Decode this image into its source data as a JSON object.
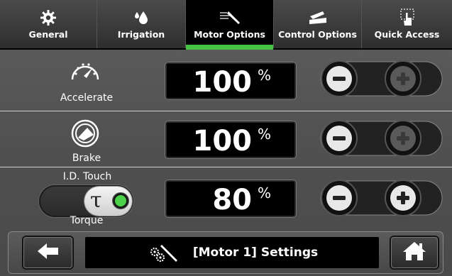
{
  "tabs": [
    {
      "label": "General",
      "icon": "gear-icon",
      "active": false
    },
    {
      "label": "Irrigation",
      "icon": "water-drops-icon",
      "active": false
    },
    {
      "label": "Motor Options",
      "icon": "handpiece-icon",
      "active": true
    },
    {
      "label": "Control Options",
      "icon": "foot-pedal-icon",
      "active": false
    },
    {
      "label": "Quick Access",
      "icon": "touch-hand-icon",
      "active": false
    }
  ],
  "settings": {
    "accelerate": {
      "label": "Accelerate",
      "value": "100",
      "unit": "%"
    },
    "brake": {
      "label": "Brake",
      "value": "100",
      "unit": "%"
    },
    "torque": {
      "label": "Torque",
      "toggle_label": "I.D. Touch",
      "toggle_symbol": "τ",
      "value": "80",
      "unit": "%"
    }
  },
  "footer": {
    "title": "[Motor 1] Settings",
    "back_icon": "back-arrow-icon",
    "home_icon": "home-icon"
  },
  "colors": {
    "accent_green": "#45c144",
    "background": "#4f4f4f",
    "value_box": "#000000"
  }
}
